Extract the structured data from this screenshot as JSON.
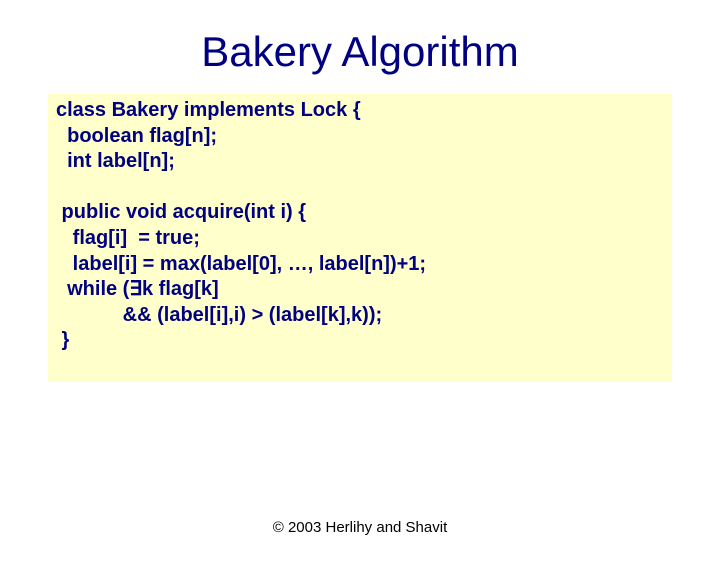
{
  "title": "Bakery Algorithm",
  "code": {
    "l1": "class Bakery implements Lock {",
    "l2": "  boolean flag[n];",
    "l3": "  int label[n];",
    "l4": "",
    "l5": " public void acquire(int i) {",
    "l6": "   flag[i]  = true;",
    "l7": "   label[i] = max(label[0], …, label[n])+1;",
    "l8": "  while (∃k flag[k]",
    "l9": "            && (label[i],i) > (label[k],k));",
    "l10": " }"
  },
  "footer": "© 2003 Herlihy and Shavit"
}
